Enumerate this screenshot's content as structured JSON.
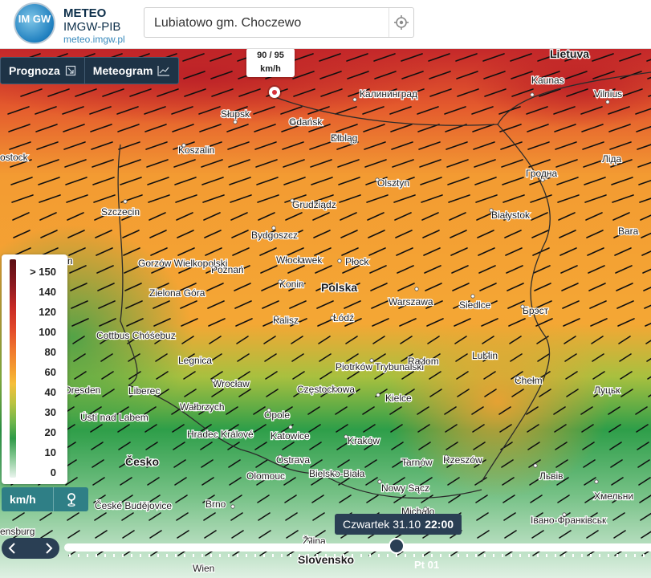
{
  "brand": {
    "logo_text": "IM GW",
    "title": "METEO",
    "subtitle": "IMGW-PIB",
    "url": "meteo.imgw.pl"
  },
  "search": {
    "value": "Lubiatowo gm. Choczewo",
    "locate_icon": "crosshair-icon"
  },
  "tabs": [
    {
      "label": "Prognoza",
      "icon": "export-icon"
    },
    {
      "label": "Meteogram",
      "icon": "chart-icon"
    }
  ],
  "tooltip": {
    "value": "90 / 95",
    "unit": "km/h"
  },
  "map": {
    "labels": [
      {
        "text": "Lietuva",
        "cls": "country"
      },
      {
        "text": "Kaunas",
        "cls": "city"
      },
      {
        "text": "Vilnius",
        "cls": "city"
      },
      {
        "text": "Калининград",
        "cls": "city"
      },
      {
        "text": "Słupsk",
        "cls": "city"
      },
      {
        "text": "Gdańsk",
        "cls": "city"
      },
      {
        "text": "Elbląg",
        "cls": "city"
      },
      {
        "text": "Koszalin",
        "cls": "city"
      },
      {
        "text": "ostock",
        "cls": "city"
      },
      {
        "text": "Olsztyn",
        "cls": "city"
      },
      {
        "text": "Гродна",
        "cls": "city"
      },
      {
        "text": "Ліда",
        "cls": "city"
      },
      {
        "text": "Szczecin",
        "cls": "city"
      },
      {
        "text": "Grudziądz",
        "cls": "city"
      },
      {
        "text": "Białystok",
        "cls": "city"
      },
      {
        "text": "Bydgoszcz",
        "cls": "city"
      },
      {
        "text": "Bara",
        "cls": "city"
      },
      {
        "text": "Berlin",
        "cls": "city"
      },
      {
        "text": "Gorzów Wielkopolski",
        "cls": "city"
      },
      {
        "text": "Poznań",
        "cls": "city"
      },
      {
        "text": "Włocławek",
        "cls": "city"
      },
      {
        "text": "Płock",
        "cls": "city"
      },
      {
        "text": "Konin",
        "cls": "city"
      },
      {
        "text": "Polska",
        "cls": "country"
      },
      {
        "text": "Zielona Góra",
        "cls": "city"
      },
      {
        "text": "Warszawa",
        "cls": "city"
      },
      {
        "text": "Siedlce",
        "cls": "city"
      },
      {
        "text": "Брэст",
        "cls": "city"
      },
      {
        "text": "Kalisz",
        "cls": "city"
      },
      {
        "text": "Łódź",
        "cls": "city"
      },
      {
        "text": "Cottbus Chóśebuz",
        "cls": "city"
      },
      {
        "text": "Legnica",
        "cls": "city"
      },
      {
        "text": "Piotrków Trybunalski",
        "cls": "city"
      },
      {
        "text": "Radom",
        "cls": "city"
      },
      {
        "text": "Lublin",
        "cls": "city"
      },
      {
        "text": "Chełm",
        "cls": "city"
      },
      {
        "text": "Луцьк",
        "cls": "city"
      },
      {
        "text": "Wrocław",
        "cls": "city"
      },
      {
        "text": "Dresden",
        "cls": "city"
      },
      {
        "text": "Liberec",
        "cls": "city"
      },
      {
        "text": "Częstochowa",
        "cls": "city"
      },
      {
        "text": "Kielce",
        "cls": "city"
      },
      {
        "text": "Wałbrzych",
        "cls": "city"
      },
      {
        "text": "Opole",
        "cls": "city"
      },
      {
        "text": "Ústí nad Labem",
        "cls": "city"
      },
      {
        "text": "Katowice",
        "cls": "city"
      },
      {
        "text": "Kraków",
        "cls": "city"
      },
      {
        "text": "Hradec Králové",
        "cls": "city"
      },
      {
        "text": "Rzeszów",
        "cls": "city"
      },
      {
        "text": "Tarnów",
        "cls": "city"
      },
      {
        "text": "Ostrava",
        "cls": "city"
      },
      {
        "text": "Česko",
        "cls": "country"
      },
      {
        "text": "Olomouc",
        "cls": "city"
      },
      {
        "text": "Bielsko-Biała",
        "cls": "city"
      },
      {
        "text": "Nowy Sącz",
        "cls": "city"
      },
      {
        "text": "Львів",
        "cls": "city"
      },
      {
        "text": "Хмельни",
        "cls": "city"
      },
      {
        "text": "České Budějovice",
        "cls": "city"
      },
      {
        "text": "Brno",
        "cls": "city"
      },
      {
        "text": "Michalo",
        "cls": "city"
      },
      {
        "text": "Івано-Франківськ",
        "cls": "city"
      },
      {
        "text": "ensburg",
        "cls": "city"
      },
      {
        "text": "Žilina",
        "cls": "city"
      },
      {
        "text": "Slovensko",
        "cls": "country"
      },
      {
        "text": "Wien",
        "cls": "city"
      }
    ]
  },
  "legend": {
    "labels": [
      "> 150",
      "140",
      "120",
      "100",
      "80",
      "60",
      "40",
      "30",
      "20",
      "10",
      "0"
    ],
    "colors": [
      "#5b0f14",
      "#8e1a20",
      "#c72a25",
      "#e24a2a",
      "#f07a2e",
      "#f5a531",
      "#f6bf3a",
      "#b8c341",
      "#6bb54c",
      "#2f9a48",
      "#eaf4ee"
    ]
  },
  "unit_control": {
    "label": "km/h",
    "icon": "map-pin-icon"
  },
  "timeline": {
    "date": "Czwartek 31.10",
    "time": "22:00",
    "day": "Pt 01",
    "prev_icon": "chevron-left-icon",
    "next_icon": "chevron-right-icon"
  }
}
